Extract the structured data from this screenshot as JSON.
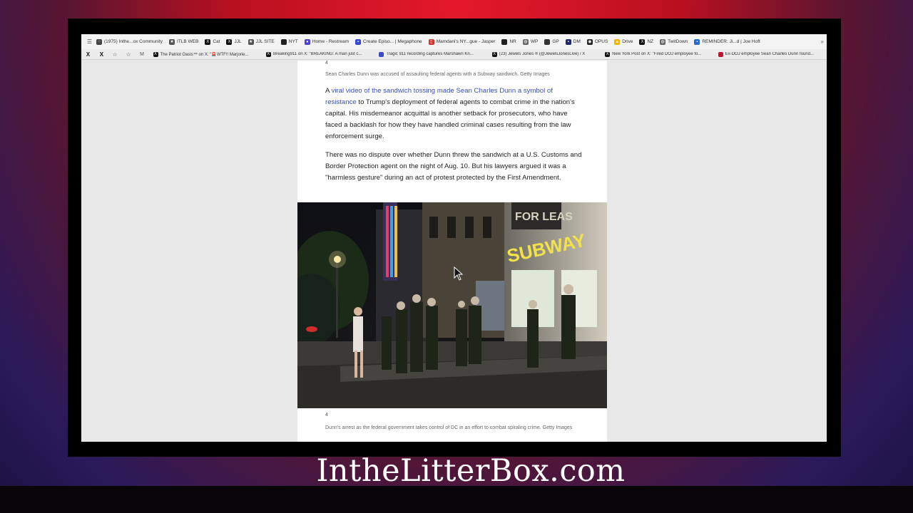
{
  "bookmarks": [
    {
      "label": "(1975) Inthe...ox Community",
      "icon": "grid-icon",
      "color": "#444444"
    },
    {
      "label": "ITLB WEB",
      "icon": "cat-icon",
      "color": "#555555"
    },
    {
      "label": "Cat",
      "icon": "x-icon",
      "color": "#111111"
    },
    {
      "label": "JJL",
      "icon": "x-icon",
      "color": "#111111"
    },
    {
      "label": "JJL SITE",
      "icon": "cat-icon",
      "color": "#555555"
    },
    {
      "label": "NYT",
      "icon": "nyt-icon",
      "color": "#222222"
    },
    {
      "label": "Home - Restream",
      "icon": "restream-icon",
      "color": "#4a3fd0"
    },
    {
      "label": "Create Episo... | Megaphone",
      "icon": "megaphone-icon",
      "color": "#3a48d6"
    },
    {
      "label": "Mamdani's NY...gue - Jasper",
      "icon": "page-icon",
      "color": "#cc3333"
    },
    {
      "label": "NR",
      "icon": "nr-icon",
      "color": "#222222"
    },
    {
      "label": "WP",
      "icon": "globe-icon",
      "color": "#666666"
    },
    {
      "label": "GP",
      "icon": "gp-icon",
      "color": "#333333"
    },
    {
      "label": "DM",
      "icon": "dm-icon",
      "color": "#1a2a6a"
    },
    {
      "label": "OPUS",
      "icon": "opus-icon",
      "color": "#222222"
    },
    {
      "label": "Drive",
      "icon": "drive-icon",
      "color": "#f0b400"
    },
    {
      "label": "NZ",
      "icon": "x-icon",
      "color": "#111111"
    },
    {
      "label": "TwitDown",
      "icon": "globe-icon",
      "color": "#666666"
    },
    {
      "label": "REMINDER: Ji...d | Joe Hoft",
      "icon": "jh-icon",
      "color": "#2a6ad0"
    }
  ],
  "tabs": [
    {
      "label": "The Patriot Oasis™ on X: \"🚨WTF!! Marjorie...",
      "icon": "x-icon"
    },
    {
      "label": "Breaking911 on X: \"BREAKING: A man just c...",
      "icon": "x-icon"
    },
    {
      "label": "Tragic 911 recording captures Marshawn Kn...",
      "icon": "news-icon"
    },
    {
      "label": "(23) Jewels Jones ® (@JewelsJonesLive) / X",
      "icon": "x-icon"
    },
    {
      "label": "New York Post on X: \"Fired DOJ employee fo...",
      "icon": "x-icon"
    },
    {
      "label": "Ex-DOJ employee Sean Charles Dunn found...",
      "icon": "nypost-icon"
    }
  ],
  "article": {
    "top_number": "4",
    "top_caption": "Sean Charles Dunn was accused of assaulting federal agents with a Subway sandwich. Getty Images",
    "para1_prefix": "A ",
    "para1_link": "viral video of the sandwich tossing made Sean Charles Dunn a symbol of resistance",
    "para1_rest": " to Trump's deployment of federal agents to combat crime in the nation's capital. His misdemeanor acquittal is another setback for prosecutors, who have faced a backlash for how they have handled criminal cases resulting from the law enforcement surge.",
    "para2": "There was no dispute over whether Dunn threw the sandwich at a U.S. Customs and Border Protection agent on the night of Aug. 10. But his lawyers argued it was a \"harmless gesture\" during an act of protest protected by the First Amendment.",
    "photo_sign": "SUBWAY",
    "photo_sign2": "FOR LEAS",
    "bottom_number": "4",
    "bottom_caption": "Dunn's arrest as the federal government takes control of DC in an effort to combat spiraling crime. Getty Images"
  },
  "watermark": "IntheLitterBox.com"
}
